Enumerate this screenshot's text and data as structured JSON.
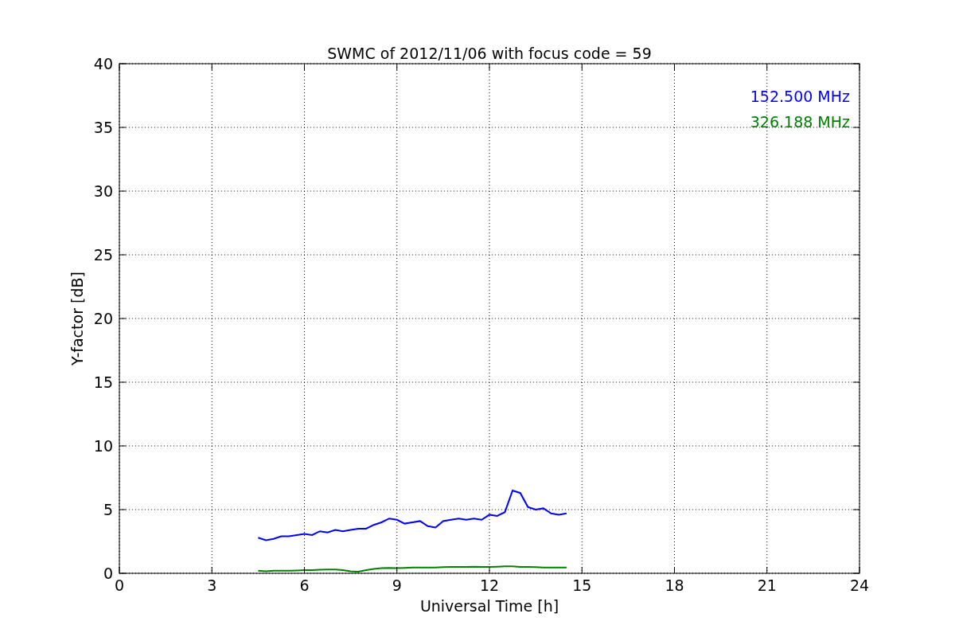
{
  "chart_data": {
    "type": "line",
    "title": "SWMC of 2012/11/06 with focus code = 59",
    "xlabel": "Universal Time [h]",
    "ylabel": "Y-factor [dB]",
    "x": [
      4.5,
      4.75,
      5,
      5.25,
      5.5,
      5.75,
      6,
      6.25,
      6.5,
      6.75,
      7,
      7.25,
      7.5,
      7.75,
      8,
      8.25,
      8.5,
      8.75,
      9,
      9.25,
      9.5,
      9.75,
      10,
      10.25,
      10.5,
      10.75,
      11,
      11.25,
      11.5,
      11.75,
      12,
      12.25,
      12.5,
      12.75,
      13,
      13.25,
      13.5,
      13.75,
      14,
      14.25,
      14.5
    ],
    "series": [
      {
        "name": "152.500 MHz",
        "color": "#0000ff",
        "values": [
          2.8,
          2.6,
          2.7,
          2.9,
          2.9,
          3.0,
          3.1,
          3.0,
          3.3,
          3.2,
          3.4,
          3.3,
          3.4,
          3.5,
          3.5,
          3.8,
          4.0,
          4.3,
          4.2,
          3.9,
          4.0,
          4.1,
          3.7,
          3.6,
          4.1,
          4.2,
          4.3,
          4.2,
          4.3,
          4.2,
          4.6,
          4.5,
          4.8,
          6.5,
          6.3,
          5.2,
          5.0,
          5.1,
          4.7,
          4.6,
          4.7
        ]
      },
      {
        "name": "326.188 MHz",
        "color": "#008000",
        "values": [
          0.2,
          0.15,
          0.2,
          0.2,
          0.2,
          0.22,
          0.25,
          0.25,
          0.28,
          0.3,
          0.3,
          0.25,
          0.15,
          0.12,
          0.25,
          0.35,
          0.4,
          0.42,
          0.4,
          0.42,
          0.45,
          0.45,
          0.45,
          0.45,
          0.48,
          0.5,
          0.5,
          0.5,
          0.52,
          0.5,
          0.5,
          0.52,
          0.55,
          0.55,
          0.5,
          0.5,
          0.48,
          0.45,
          0.45,
          0.45,
          0.45
        ]
      }
    ],
    "xlim": [
      0,
      24
    ],
    "ylim": [
      0,
      40
    ],
    "xticks": [
      0,
      3,
      6,
      9,
      12,
      15,
      18,
      21,
      24
    ],
    "yticks": [
      0,
      5,
      10,
      15,
      20,
      25,
      30,
      35,
      40
    ],
    "grid": true
  }
}
